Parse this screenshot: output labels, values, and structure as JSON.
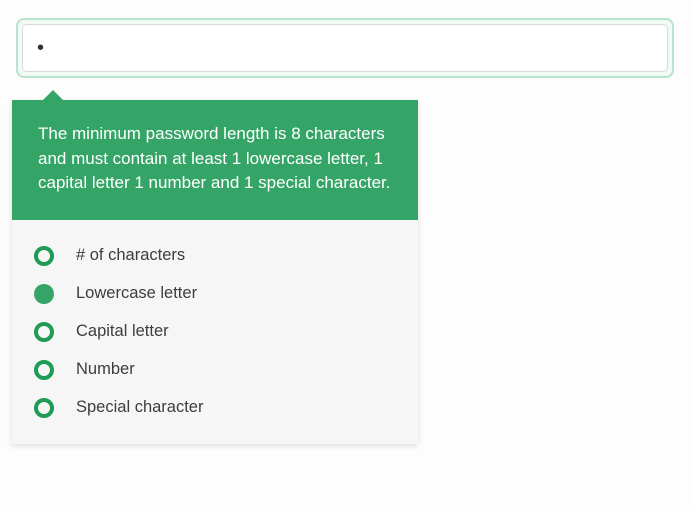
{
  "input": {
    "value": "•",
    "placeholder": ""
  },
  "tooltip": {
    "description": "The minimum password length is 8 characters and must contain at least 1 lowercase letter, 1 capital letter 1 number and 1 special character."
  },
  "requirements": [
    {
      "label": "# of characters",
      "met": false
    },
    {
      "label": "Lowercase letter",
      "met": true
    },
    {
      "label": "Capital letter",
      "met": false
    },
    {
      "label": "Number",
      "met": false
    },
    {
      "label": "Special character",
      "met": false
    }
  ]
}
